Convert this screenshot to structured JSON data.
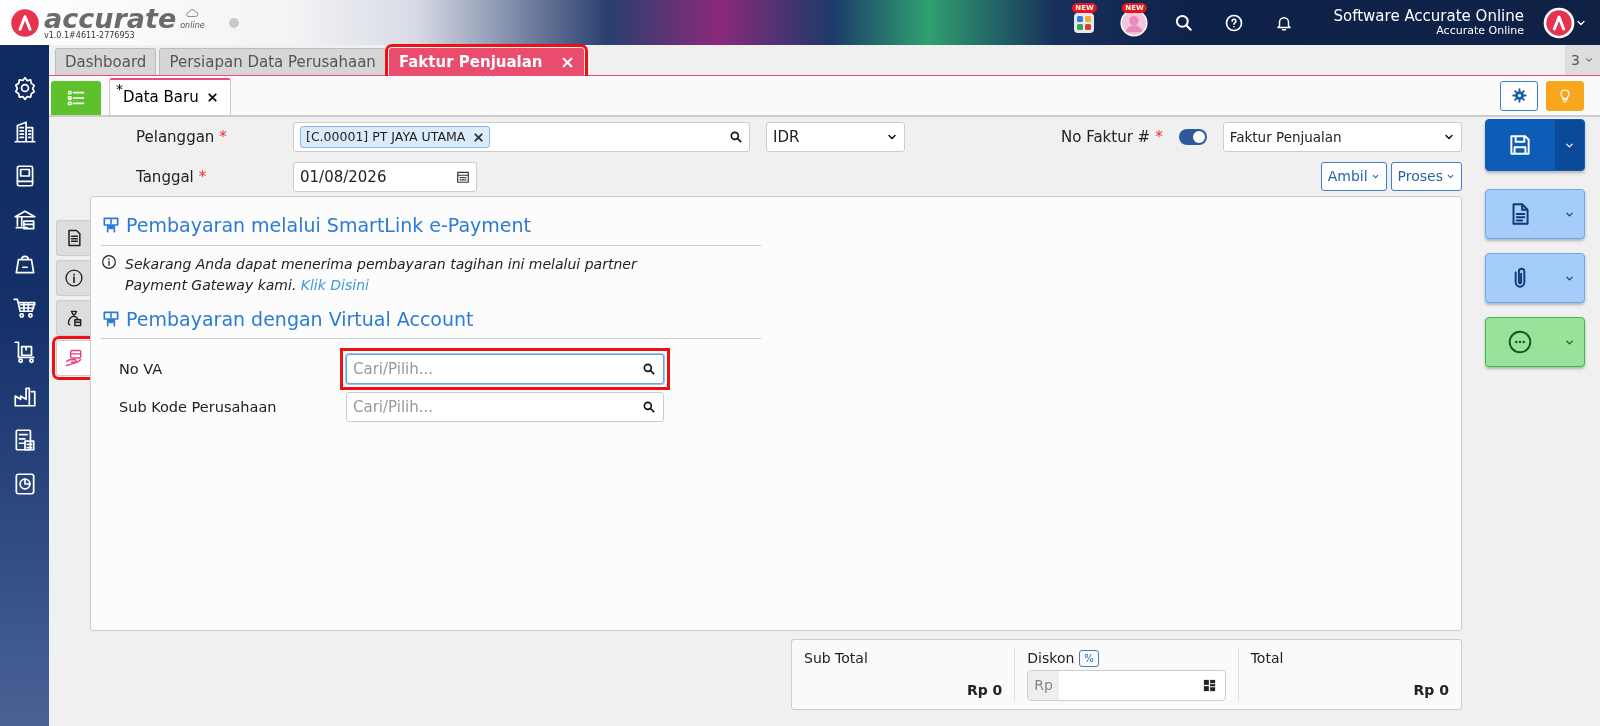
{
  "app": {
    "brand": "accurate",
    "brand_sub": "online",
    "version": "v1.0.1#4611-2776953"
  },
  "header": {
    "badges": [
      "NEW",
      "NEW"
    ],
    "user_name": "Software Accurate Online",
    "company": "Accurate Online"
  },
  "sidebar": {
    "items": [
      {
        "kind": "gear"
      },
      {
        "kind": "building"
      },
      {
        "kind": "book"
      },
      {
        "kind": "bank"
      },
      {
        "kind": "bag"
      },
      {
        "kind": "cart"
      },
      {
        "kind": "trolley"
      },
      {
        "kind": "factory"
      },
      {
        "kind": "tax"
      },
      {
        "kind": "report"
      }
    ]
  },
  "tabs": [
    {
      "label": "Dashboard",
      "selected": false,
      "closable": false,
      "highlighted": false
    },
    {
      "label": "Persiapan Data Perusahaan",
      "selected": false,
      "closable": false,
      "highlighted": false
    },
    {
      "label": "Faktur Penjualan",
      "selected": true,
      "closable": true,
      "highlighted": true
    }
  ],
  "tab_count": "3",
  "sub_tabs": [
    {
      "label": "Data Baru",
      "marker": "*",
      "selected": true
    }
  ],
  "form": {
    "customer": {
      "label": "Pelanggan",
      "required": true,
      "tag": "[C.00001] PT JAYA UTAMA"
    },
    "date": {
      "label": "Tanggal",
      "required": true,
      "value": "01/08/2026"
    },
    "currency": "IDR",
    "invoice_no": {
      "label": "No Faktur #",
      "required": true,
      "auto": true,
      "type": "Faktur Penjualan"
    },
    "buttons": [
      "Ambil",
      "Proses"
    ]
  },
  "side_tabs": [
    {
      "kind": "document",
      "selected": false,
      "highlighted": false
    },
    {
      "kind": "info",
      "selected": false,
      "highlighted": false
    },
    {
      "kind": "money",
      "selected": false,
      "highlighted": false
    },
    {
      "kind": "payment",
      "selected": true,
      "highlighted": true
    }
  ],
  "panel": {
    "sections": [
      {
        "title": "Pembayaran melalui SmartLink e-Payment",
        "note": "Sekarang Anda dapat menerima pembayaran tagihan ini melalui partner Payment Gateway kami.",
        "link": "Klik Disini"
      },
      {
        "title": "Pembayaran dengan Virtual Account",
        "fields": [
          {
            "label": "No VA",
            "placeholder": "Cari/Pilih...",
            "focused": true,
            "highlighted": true
          },
          {
            "label": "Sub Kode Perusahaan",
            "placeholder": "Cari/Pilih...",
            "focused": false,
            "highlighted": false
          }
        ]
      }
    ]
  },
  "actions": [
    {
      "kind": "save"
    },
    {
      "kind": "document"
    },
    {
      "kind": "attachment"
    },
    {
      "kind": "more"
    }
  ],
  "totals": {
    "sub_total": {
      "label": "Sub Total",
      "value": "Rp 0"
    },
    "discount": {
      "label": "Diskon",
      "badge": "%",
      "prefix": "Rp"
    },
    "total": {
      "label": "Total",
      "value": "Rp 0"
    }
  }
}
